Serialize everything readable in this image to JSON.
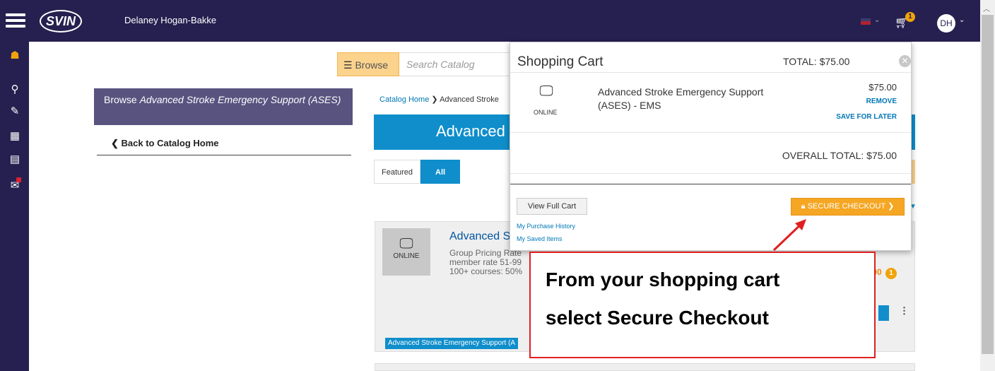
{
  "header": {
    "logo_text": "SVIN",
    "user_name": "Delaney Hogan-Bakke",
    "cart_count": "1",
    "avatar_initials": "DH",
    "background": "#262050"
  },
  "sidenav": {
    "items": [
      {
        "icon": "home-icon",
        "glyph": "☗"
      },
      {
        "icon": "search-icon",
        "glyph": "⚲"
      },
      {
        "icon": "edit-icon",
        "glyph": "✎"
      },
      {
        "icon": "catalog-icon",
        "glyph": "▦"
      },
      {
        "icon": "calendar-icon",
        "glyph": "▤"
      },
      {
        "icon": "mail-icon",
        "glyph": "✉"
      }
    ]
  },
  "search": {
    "browse_label": "Browse",
    "placeholder": "Search Catalog"
  },
  "browse_panel": {
    "prefix": "Browse",
    "category": "Advanced Stroke Emergency Support (ASES)",
    "back_link": "Back to Catalog Home"
  },
  "breadcrumb": {
    "home": "Catalog Home",
    "current": "Advanced Stroke"
  },
  "banner": {
    "title": "Advanced"
  },
  "tabs": [
    {
      "label": "Featured"
    },
    {
      "label": "All"
    }
  ],
  "course_card": {
    "thumb_label": "ONLINE",
    "title": "Advanced S",
    "desc_lines": [
      "Group Pricing Rate",
      "member rate 51-99",
      "100+ courses: 50%"
    ],
    "price_fragment": ".00",
    "badge": "1",
    "tag": "Advanced Stroke Emergency Support (A"
  },
  "cart": {
    "title": "Shopping Cart",
    "total": "TOTAL: $75.00",
    "item": {
      "type_label": "ONLINE",
      "name": "Advanced Stroke Emergency Support (ASES) - EMS",
      "price": "$75.00",
      "remove_label": "REMOVE",
      "save_label": "SAVE FOR LATER"
    },
    "overall_total": "OVERALL TOTAL: $75.00",
    "view_full_cart": "View Full Cart",
    "purchase_history": "My Purchase History",
    "saved_items": "My Saved Items",
    "checkout_label": "SECURE CHECKOUT"
  },
  "callout": {
    "line1": "From your shopping cart",
    "line2": "select Secure Checkout",
    "border_color": "#e02020"
  },
  "colors": {
    "accent_blue": "#0f8ecb",
    "accent_orange": "#f5a623",
    "link_blue": "#0077b6"
  }
}
